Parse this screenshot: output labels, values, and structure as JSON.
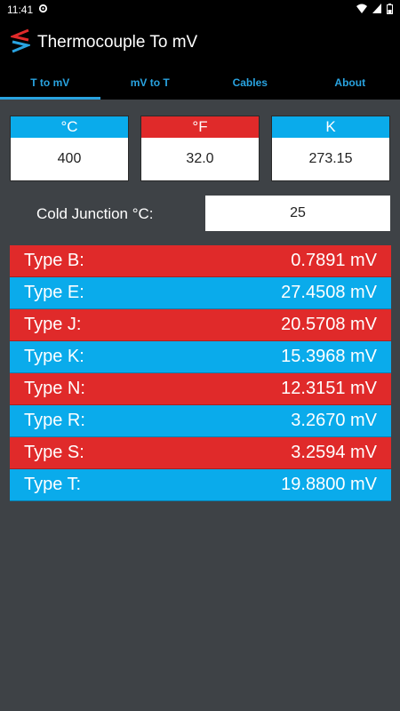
{
  "status": {
    "time": "11:41"
  },
  "app": {
    "title": "Thermocouple To mV"
  },
  "tabs": [
    {
      "label": "T to mV",
      "active": true
    },
    {
      "label": "mV to T",
      "active": false
    },
    {
      "label": "Cables",
      "active": false
    },
    {
      "label": "About",
      "active": false
    }
  ],
  "units": [
    {
      "label": "°C",
      "value": "400",
      "color": "#0aabeb"
    },
    {
      "label": "°F",
      "value": "32.0",
      "color": "#e02a2a"
    },
    {
      "label": "K",
      "value": "273.15",
      "color": "#0aabeb"
    }
  ],
  "cold_junction": {
    "label": "Cold Junction °C:",
    "value": "25"
  },
  "types": [
    {
      "label": "Type B:",
      "value": "0.7891 mV",
      "color": "#e02a2a"
    },
    {
      "label": "Type E:",
      "value": "27.4508 mV",
      "color": "#0aabeb"
    },
    {
      "label": "Type J:",
      "value": "20.5708 mV",
      "color": "#e02a2a"
    },
    {
      "label": "Type K:",
      "value": "15.3968 mV",
      "color": "#0aabeb"
    },
    {
      "label": "Type N:",
      "value": "12.3151 mV",
      "color": "#e02a2a"
    },
    {
      "label": "Type R:",
      "value": "3.2670 mV",
      "color": "#0aabeb"
    },
    {
      "label": "Type S:",
      "value": "3.2594 mV",
      "color": "#e02a2a"
    },
    {
      "label": "Type T:",
      "value": "19.8800 mV",
      "color": "#0aabeb"
    }
  ]
}
